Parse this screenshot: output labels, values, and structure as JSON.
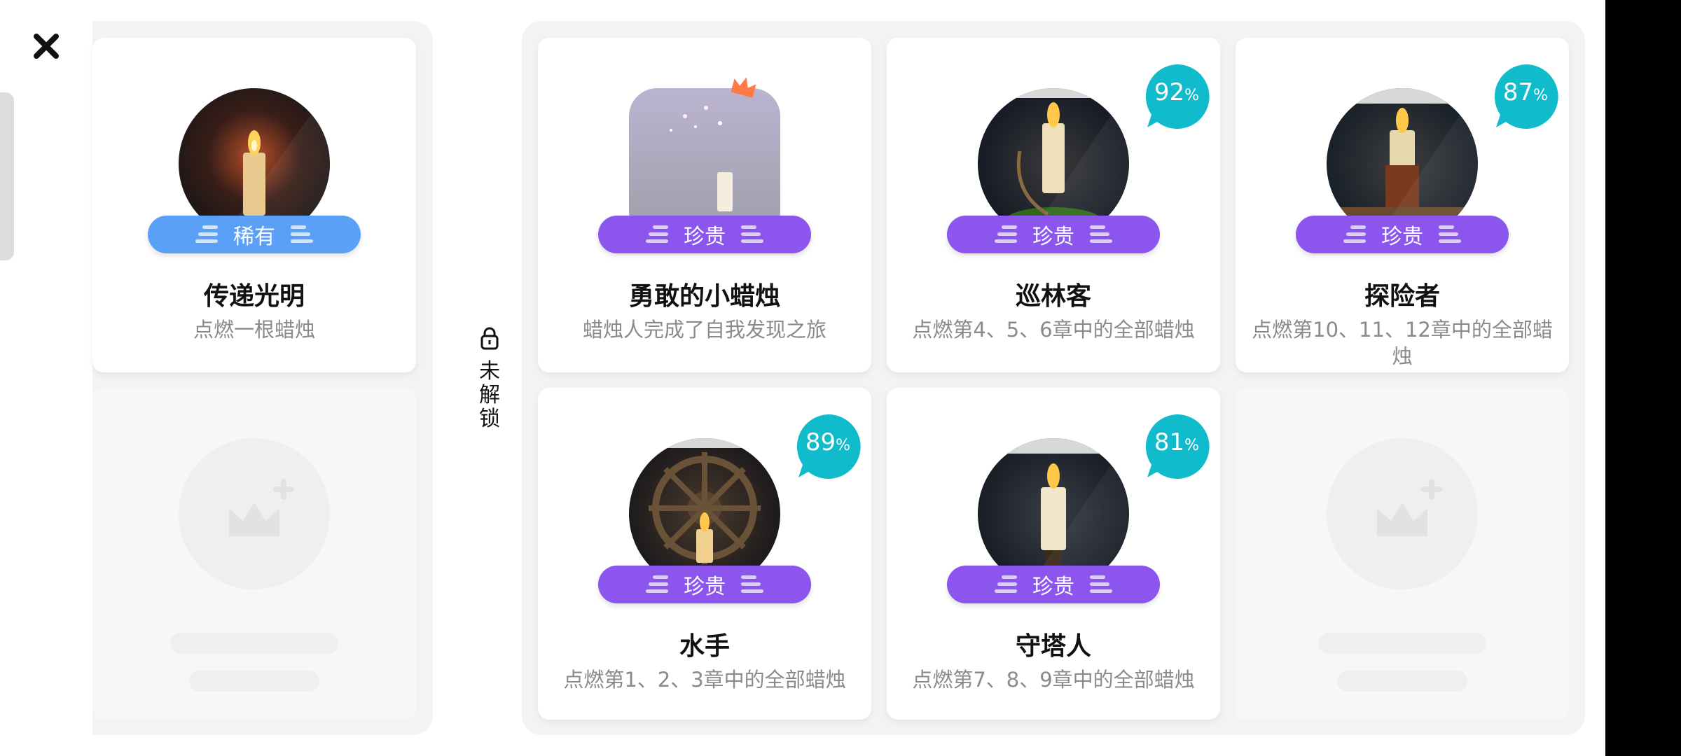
{
  "close_icon": "close-icon",
  "lock_section": {
    "label": "未解锁",
    "icon": "lock-icon"
  },
  "colors": {
    "rare": "#5aa0f6",
    "precious": "#8b55ee",
    "percent_bubble": "#10bccb"
  },
  "achievements": [
    {
      "id": "pass-light",
      "title": "传递光明",
      "desc": "点燃一根蜡烛",
      "badge": "稀有",
      "tier": "rare"
    },
    {
      "id": "brave-candle",
      "title": "勇敢的小蜡烛",
      "desc": "蜡烛人完成了自我发现之旅",
      "badge": "珍贵",
      "tier": "precious"
    },
    {
      "id": "ranger",
      "title": "巡林客",
      "desc": "点燃第4、5、6章中的全部蜡烛",
      "badge": "珍贵",
      "tier": "precious",
      "percent": "92",
      "percent_unit": "%"
    },
    {
      "id": "explorer",
      "title": "探险者",
      "desc": "点燃第10、11、12章中的全部蜡烛",
      "badge": "珍贵",
      "tier": "precious",
      "percent": "87",
      "percent_unit": "%"
    },
    {
      "id": "sailor",
      "title": "水手",
      "desc": "点燃第1、2、3章中的全部蜡烛",
      "badge": "珍贵",
      "tier": "precious",
      "percent": "89",
      "percent_unit": "%"
    },
    {
      "id": "tower-keeper",
      "title": "守塔人",
      "desc": "点燃第7、8、9章中的全部蜡烛",
      "badge": "珍贵",
      "tier": "precious",
      "percent": "81",
      "percent_unit": "%"
    }
  ]
}
